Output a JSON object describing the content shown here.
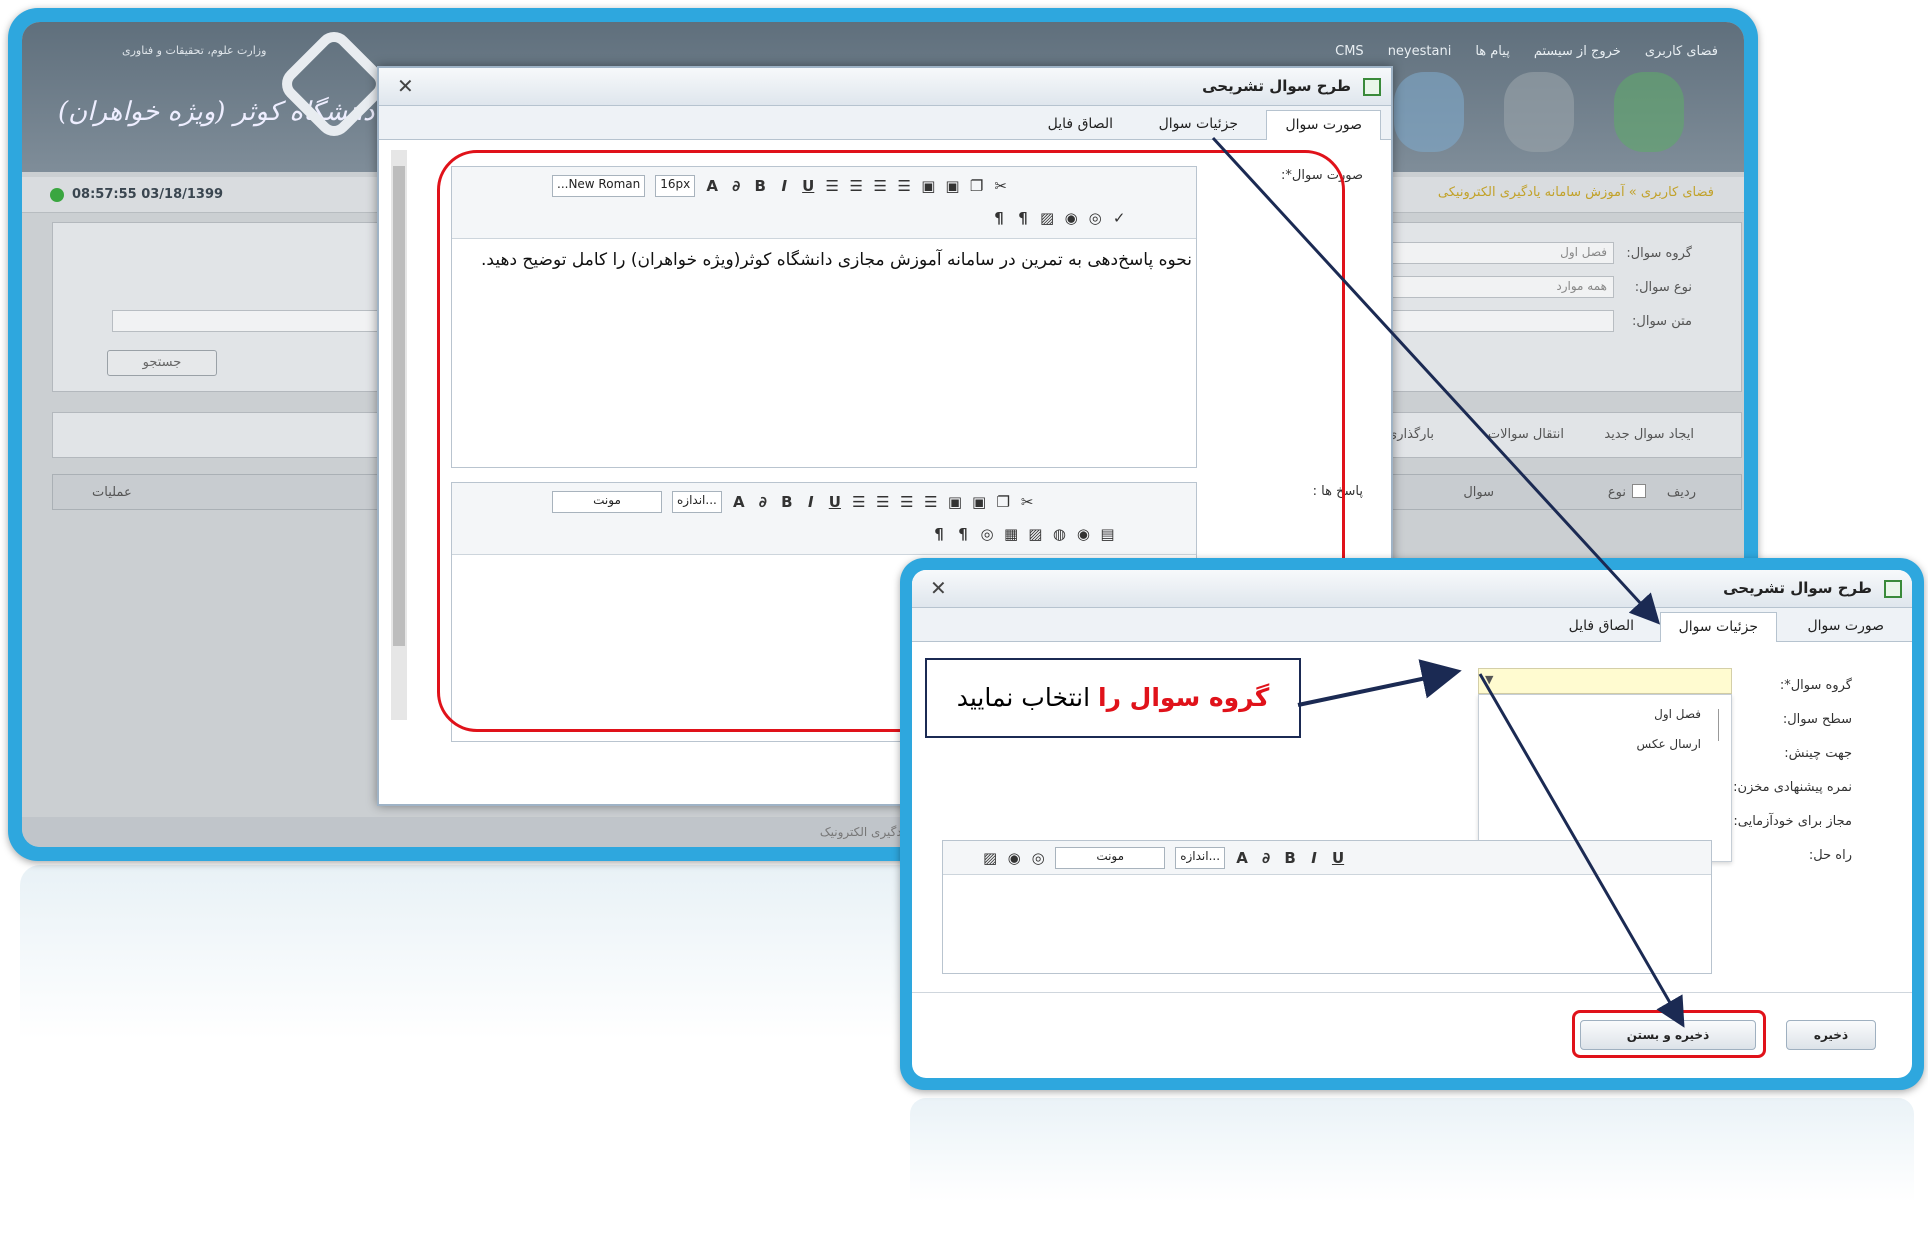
{
  "back_window": {
    "top_menu": [
      "فضای کاربری",
      "خروج از سیستم",
      "پیام ها",
      "neyestani",
      "CMS"
    ],
    "ministry": "وزارت علوم، تحقیقات و فناوری",
    "university": "دانشگاه کوثر (ویژه خواهران)",
    "clock": "08:57:55 03/18/1399",
    "breadcrumb": "فضای کاربری » آموزش سامانه یادگیری الکترونیکی",
    "filter": {
      "group_label": "گروه سوال:",
      "group_value": "فصل اول",
      "type_label": "نوع سوال:",
      "type_value": "همه موارد",
      "text_label": "متن سوال:"
    },
    "search_button": "جستجو",
    "actions": [
      "ایجاد سوال جدید",
      "انتقال سوالات",
      "بارگذاری"
    ],
    "grid_columns": {
      "row": "ردیف",
      "type": "نوع",
      "question": "سوال",
      "operations": "عملیات"
    },
    "footer": "سامانه یادگیری الکترونیک"
  },
  "dialog1": {
    "title": "طرح سوال تشریحی",
    "tabs": [
      "صورت سوال",
      "جزئیات سوال",
      "الصاق فایل"
    ],
    "question_label": "صورت سوال*:",
    "answers_label": "پاسخ ها :",
    "editor1": {
      "font": "...New Roman",
      "size": "16px",
      "text": "نحوه پاسخ‌دهی به تمرین در سامانه آموزش مجازی دانشگاه کوثر(ویژه خواهران) را کامل توضیح دهید."
    },
    "editor2": {
      "font": "مونت",
      "size": "اندازه..."
    }
  },
  "dialog2": {
    "title": "طرح سوال تشریحی",
    "tabs": [
      "صورت سوال",
      "جزئیات سوال",
      "الصاق فایل"
    ],
    "fields": [
      "گروه سوال*:",
      "سطح سوال:",
      "جهت چینش:",
      "نمره پیشنهادی مخزن:",
      "مجاز برای خودآزمایی:",
      "راه حل:"
    ],
    "dropdown_options": [
      "فصل اول",
      "ارسال عکس"
    ],
    "editor": {
      "font": "مونت",
      "size": "اندازه..."
    },
    "save_button": "ذخیره",
    "save_close_button": "ذخیره و بستن"
  },
  "callout": {
    "highlight": "گروه سوال را",
    "rest": "انتخاب نمایید"
  },
  "colors": {
    "frame": "#2ea7de",
    "annotation_red": "#e0121a",
    "arrow": "#1b2a53"
  }
}
